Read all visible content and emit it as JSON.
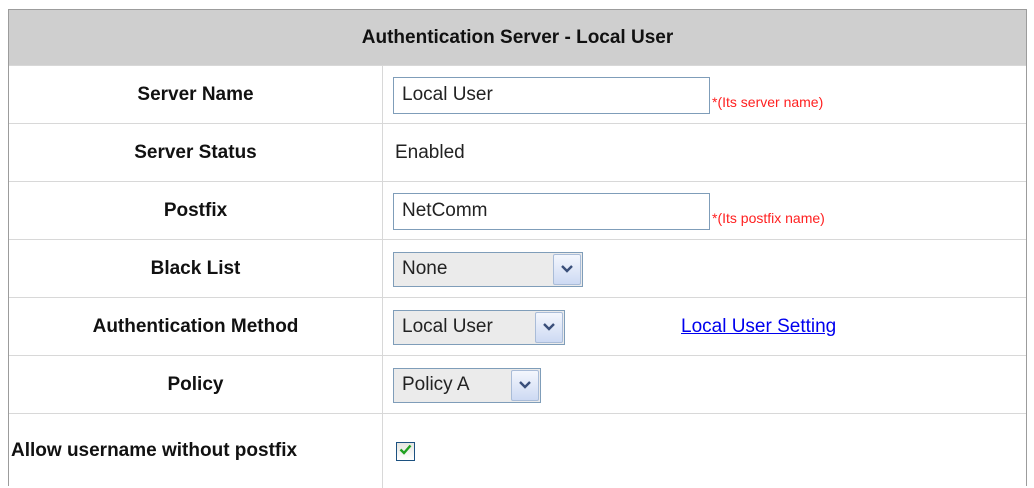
{
  "header": {
    "title": "Authentication Server - Local User"
  },
  "server_name": {
    "label": "Server Name",
    "value": "Local User",
    "hint": "*(Its server name)"
  },
  "server_status": {
    "label": "Server Status",
    "value": "Enabled"
  },
  "postfix": {
    "label": "Postfix",
    "value": "NetComm",
    "hint": "*(Its postfix name)"
  },
  "black_list": {
    "label": "Black List",
    "selected": "None"
  },
  "auth_method": {
    "label": "Authentication Method",
    "selected": "Local User",
    "link": "Local User Setting"
  },
  "policy": {
    "label": "Policy",
    "selected": "Policy A"
  },
  "allow_no_postfix": {
    "label": "Allow username without postfix",
    "checked": true
  },
  "colors": {
    "header_bg": "#cfcfcf",
    "hint": "#ff2020",
    "link": "#0000ee",
    "check": "#21a121"
  },
  "icons": {
    "dropdown": "chevron-down-icon",
    "check": "checkmark-icon"
  }
}
